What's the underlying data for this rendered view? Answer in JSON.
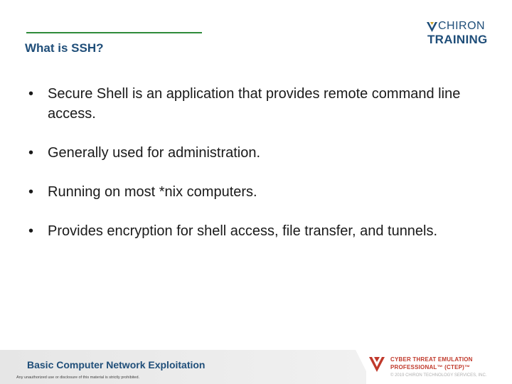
{
  "slide": {
    "title": "What is SSH?",
    "bullets": [
      "Secure Shell is an application that provides remote command line access.",
      "Generally used for administration.",
      "Running on most *nix computers.",
      "Provides encryption for shell access, file transfer, and tunnels."
    ],
    "bullet_glyph": "•"
  },
  "logo": {
    "line1": "CHIRON",
    "line2": "TRAINING",
    "icon": "chiron-shield-icon"
  },
  "footer": {
    "course": "Basic Computer Network Exploitation",
    "disclaimer": "Any unauthorized use or disclosure of this material is strictly prohibited.",
    "ctep_line1": "CYBER THREAT EMULATION",
    "ctep_line2": "PROFESSIONAL™ (CTEP)™",
    "copyright": "© 2019 CHIRON TECHNOLOGY SERVICES, INC."
  },
  "colors": {
    "accent_green": "#2e8b3a",
    "title_blue": "#1f4e79",
    "ctep_red": "#c0392b"
  }
}
